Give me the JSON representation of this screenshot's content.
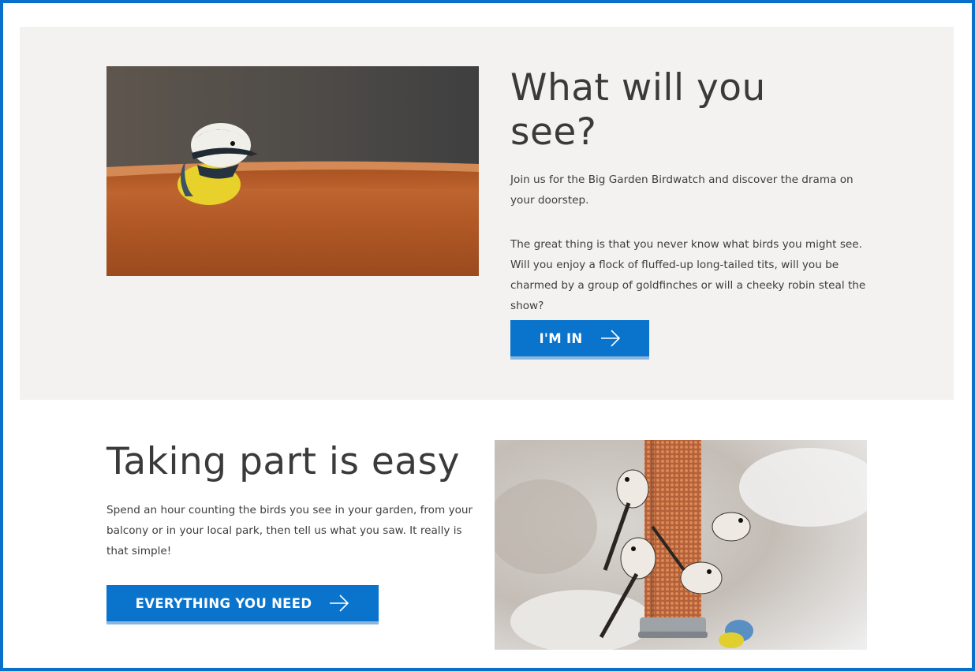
{
  "section_see": {
    "heading": "What will you see?",
    "para1": "Join us for the Big Garden Birdwatch and discover the drama on your doorstep.",
    "para2": "The great thing is that you never know what birds you might see. Will you enjoy a flock of fluffed-up long-tailed tits, will you be charmed by a group of goldfinches or will a cheeky robin steal the show?",
    "button_label": "I'M IN",
    "button_icon": "arrow-right-icon",
    "image": "blue-tit-on-flower-pot"
  },
  "section_easy": {
    "heading": "Taking part is easy",
    "para": "Spend an hour counting the birds you see in your garden, from your balcony or in your local park, then tell us what you saw. It really is that simple!",
    "button_label": "EVERYTHING YOU NEED",
    "button_icon": "arrow-right-icon",
    "image": "long-tailed-tits-on-feeder"
  },
  "colors": {
    "accent": "#0a74cc",
    "frame": "#0a6fcb",
    "panel_bg": "#f3f2f0",
    "text": "#3a3a3a"
  }
}
